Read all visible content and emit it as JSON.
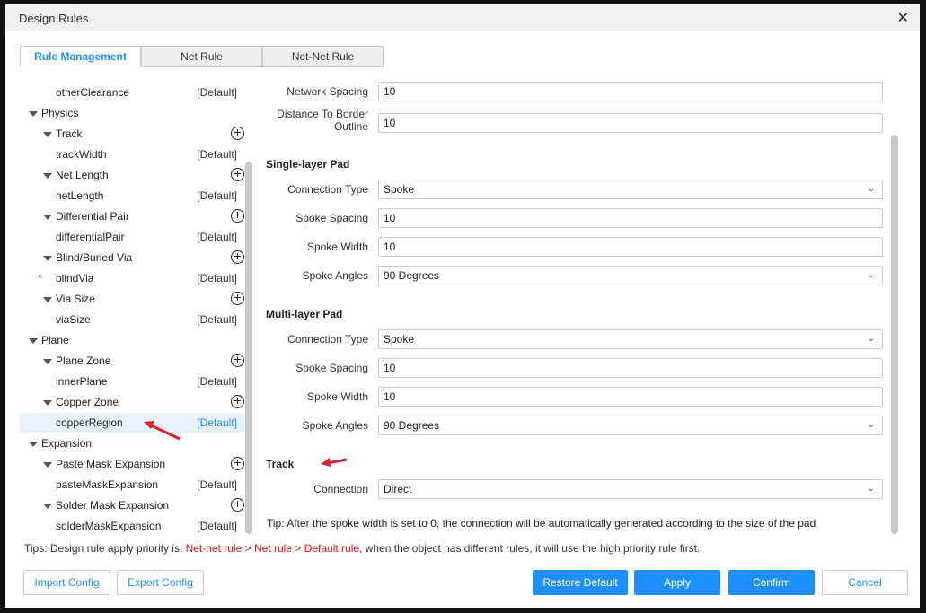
{
  "window": {
    "title": "Design Rules",
    "close_icon": "close-icon"
  },
  "tabs": [
    {
      "label": "Rule Management",
      "active": true
    },
    {
      "label": "Net Rule"
    },
    {
      "label": "Net-Net Rule"
    }
  ],
  "tree": [
    {
      "label": "otherClearance",
      "value": "[Default]",
      "level": 2
    },
    {
      "label": "Physics",
      "level": 0,
      "expanded": true
    },
    {
      "label": "Track",
      "level": 1,
      "add": true
    },
    {
      "label": "trackWidth",
      "value": "[Default]",
      "level": 2
    },
    {
      "label": "Net Length",
      "level": 1,
      "add": true
    },
    {
      "label": "netLength",
      "value": "[Default]",
      "level": 2
    },
    {
      "label": "Differential Pair",
      "level": 1,
      "add": true
    },
    {
      "label": "differentialPair",
      "value": "[Default]",
      "level": 2
    },
    {
      "label": "Blind/Buried Via",
      "level": 1,
      "add": true
    },
    {
      "label": "blindVia",
      "value": "[Default]",
      "level": 2,
      "marker": "*"
    },
    {
      "label": "Via Size",
      "level": 1,
      "add": true
    },
    {
      "label": "viaSize",
      "value": "[Default]",
      "level": 2
    },
    {
      "label": "Plane",
      "level": 0
    },
    {
      "label": "Plane Zone",
      "level": 1,
      "add": true
    },
    {
      "label": "innerPlane",
      "value": "[Default]",
      "level": 2
    },
    {
      "label": "Copper Zone",
      "level": 1,
      "add": true
    },
    {
      "label": "copperRegion",
      "value": "[Default]",
      "level": 2,
      "selected": true
    },
    {
      "label": "Expansion",
      "level": 0
    },
    {
      "label": "Paste Mask Expansion",
      "level": 1,
      "add": true
    },
    {
      "label": "pasteMaskExpansion",
      "value": "[Default]",
      "level": 2
    },
    {
      "label": "Solder Mask Expansion",
      "level": 1,
      "add": true
    },
    {
      "label": "solderMaskExpansion",
      "value": "[Default]",
      "level": 2
    }
  ],
  "form": {
    "top": [
      {
        "label": "Network Spacing",
        "value": "10"
      },
      {
        "label": "Distance To Border Outline",
        "value": "10"
      }
    ],
    "single_layer_pad": {
      "title": "Single-layer Pad",
      "fields": [
        {
          "label": "Connection Type",
          "value": "Spoke",
          "select": true
        },
        {
          "label": "Spoke Spacing",
          "value": "10"
        },
        {
          "label": "Spoke Width",
          "value": "10"
        },
        {
          "label": "Spoke Angles",
          "value": "90 Degrees",
          "select": true
        }
      ]
    },
    "multi_layer_pad": {
      "title": "Multi-layer Pad",
      "fields": [
        {
          "label": "Connection Type",
          "value": "Spoke",
          "select": true
        },
        {
          "label": "Spoke Spacing",
          "value": "10"
        },
        {
          "label": "Spoke Width",
          "value": "10"
        },
        {
          "label": "Spoke Angles",
          "value": "90 Degrees",
          "select": true
        }
      ]
    },
    "track": {
      "title": "Track",
      "fields": [
        {
          "label": "Connection",
          "value": "Direct",
          "select": true
        }
      ]
    },
    "tip": "Tip: After the spoke width is set to 0, the connection will be automatically generated according to the size of the pad"
  },
  "tips": {
    "prefix": "Tips: Design rule apply priority is: ",
    "highlight": "Net-net rule > Net rule > Default rule",
    "suffix": ", when the object has different rules, it will use the high priority rule first."
  },
  "buttons": {
    "import": "Import Config",
    "export": "Export Config",
    "restore": "Restore Default",
    "apply": "Apply",
    "confirm": "Confirm",
    "cancel": "Cancel"
  },
  "colors": {
    "accent": "#1e8fff",
    "highlight": "#e01010",
    "annotation_arrow": "#e0202a"
  }
}
